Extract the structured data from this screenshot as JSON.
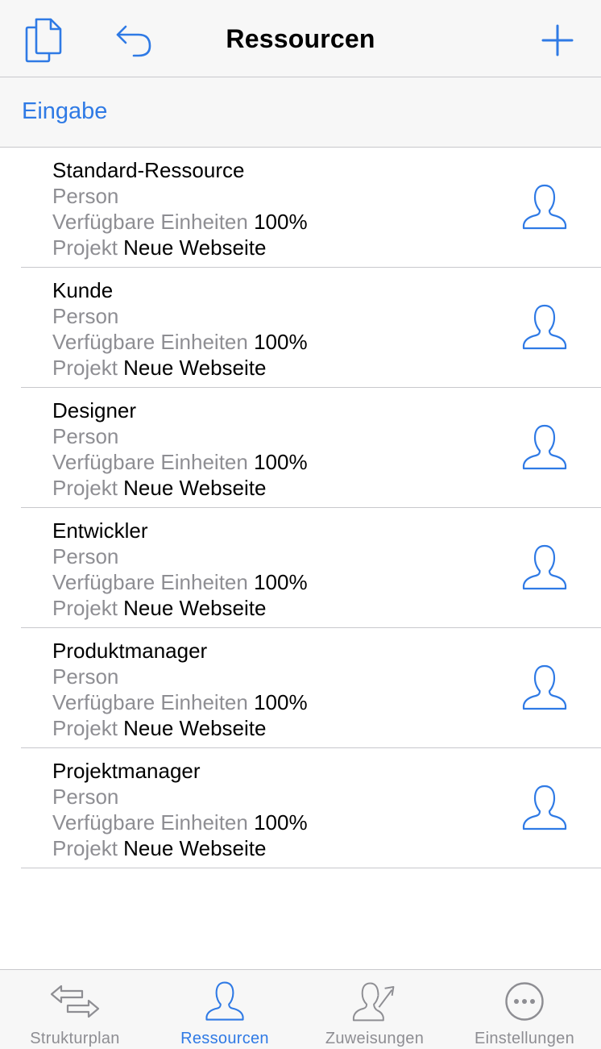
{
  "colors": {
    "accent": "#2f7ae5",
    "secondary_text": "#8e8e93",
    "separator": "#c8c8cc",
    "bar_bg": "#f7f7f7"
  },
  "navbar": {
    "title": "Ressourcen",
    "left_icons": [
      "documents-icon",
      "undo-icon"
    ],
    "right_icon": "plus-icon"
  },
  "subbar": {
    "link": "Eingabe"
  },
  "resources": [
    {
      "name": "Standard-Ressource",
      "type": "Person",
      "units_label": "Verfügbare Einheiten",
      "units_value": "100%",
      "project_label": "Projekt",
      "project_value": "Neue Webseite"
    },
    {
      "name": "Kunde",
      "type": "Person",
      "units_label": "Verfügbare Einheiten",
      "units_value": "100%",
      "project_label": "Projekt",
      "project_value": "Neue Webseite"
    },
    {
      "name": "Designer",
      "type": "Person",
      "units_label": "Verfügbare Einheiten",
      "units_value": "100%",
      "project_label": "Projekt",
      "project_value": "Neue Webseite"
    },
    {
      "name": "Entwickler",
      "type": "Person",
      "units_label": "Verfügbare Einheiten",
      "units_value": "100%",
      "project_label": "Projekt",
      "project_value": "Neue Webseite"
    },
    {
      "name": "Produktmanager",
      "type": "Person",
      "units_label": "Verfügbare Einheiten",
      "units_value": "100%",
      "project_label": "Projekt",
      "project_value": "Neue Webseite"
    },
    {
      "name": "Projektmanager",
      "type": "Person",
      "units_label": "Verfügbare Einheiten",
      "units_value": "100%",
      "project_label": "Projekt",
      "project_value": "Neue Webseite"
    }
  ],
  "tabbar": {
    "active": 1,
    "tabs": [
      {
        "label": "Strukturplan",
        "icon": "structure-arrows-icon"
      },
      {
        "label": "Ressourcen",
        "icon": "person-icon"
      },
      {
        "label": "Zuweisungen",
        "icon": "person-assign-icon"
      },
      {
        "label": "Einstellungen",
        "icon": "more-dots-icon"
      }
    ]
  }
}
